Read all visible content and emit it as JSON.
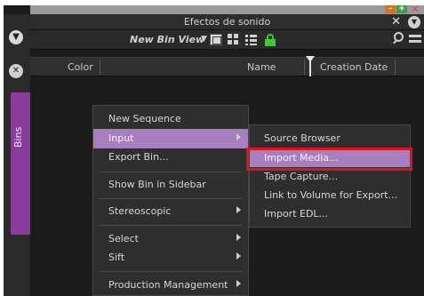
{
  "window": {
    "title": "Efectos de sonido",
    "close_glyph": "✕",
    "min_glyph": "–",
    "max_glyph": "+",
    "win_close_glyph": "×"
  },
  "rail": {
    "top_icon": "circle-chevron-down-icon",
    "close_icon": "circle-x-icon",
    "close_glyph": "✕",
    "down_glyph": "▼",
    "bins_label": "Bins"
  },
  "toolbar": {
    "bin_view_label": "New Bin View",
    "bin_view_arrow": "▼"
  },
  "columns": {
    "color": "Color",
    "name": "Name",
    "creation_date": "Creation Date"
  },
  "menu": {
    "items": [
      {
        "label": "New Sequence",
        "submenu": false
      },
      {
        "label": "Input",
        "submenu": true,
        "active": true
      },
      {
        "label": "Export Bin...",
        "submenu": false
      },
      {
        "label": "Show Bin in Sidebar",
        "submenu": false
      },
      {
        "label": "Stereoscopic",
        "submenu": true
      },
      {
        "label": "Select",
        "submenu": true
      },
      {
        "label": "Sift",
        "submenu": true
      },
      {
        "label": "Production Management",
        "submenu": true
      }
    ]
  },
  "submenu": {
    "items": [
      {
        "label": "Source Browser"
      },
      {
        "label": "Import Media...",
        "active": true
      },
      {
        "label": "Tape Capture..."
      },
      {
        "label": "Link to Volume for Export..."
      },
      {
        "label": "Import EDL..."
      }
    ]
  },
  "colors": {
    "accent_purple": "#a77fbf",
    "bins_tab": "#8a3c9c",
    "lock_green": "#3ccc2c",
    "highlight_red": "#e0121a",
    "background": "#1b1b1b"
  }
}
